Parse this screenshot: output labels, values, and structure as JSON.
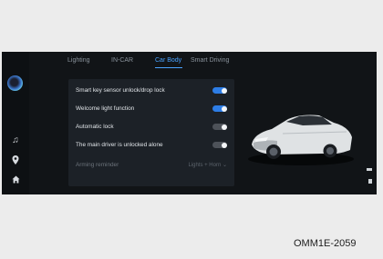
{
  "tabs": [
    {
      "label": "Lighting",
      "active": false
    },
    {
      "label": "IN-CAR",
      "active": false
    },
    {
      "label": "Car Body",
      "active": true
    },
    {
      "label": "Smart Driving",
      "active": false
    }
  ],
  "settings": [
    {
      "label": "Smart key sensor unlock/drop lock",
      "state": "on"
    },
    {
      "label": "Welcome light function",
      "state": "on"
    },
    {
      "label": "Automatic lock",
      "state": "off"
    },
    {
      "label": "The main driver is unlocked alone",
      "state": "off"
    }
  ],
  "arming": {
    "label": "Arming reminder",
    "value": "Lights + Horn"
  },
  "icons": {
    "assistant": "voice-assistant-icon",
    "music": "music-note-icon",
    "navigation": "location-pin-icon",
    "home": "home-icon"
  },
  "colors": {
    "accent": "#4aa3ff",
    "toggle_on": "#2d7de6",
    "toggle_off": "#4d5259",
    "panel": "#1c2127"
  },
  "image_code": "OMM1E-2059"
}
